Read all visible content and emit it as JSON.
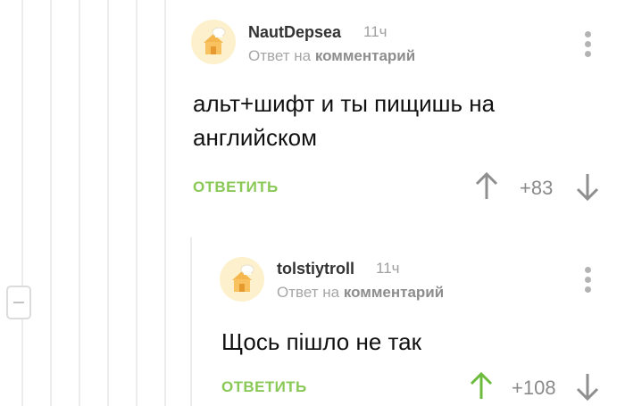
{
  "comments": [
    {
      "author": "NautDepsea",
      "time": "11ч",
      "reply_prefix": "Ответ на",
      "reply_target": "комментарий",
      "text": "альт+шифт и ты пищишь на английском",
      "reply_label": "ОТВЕТИТЬ",
      "score": "+83",
      "upvoted": false
    },
    {
      "author": "tolstiytroll",
      "time": "11ч",
      "reply_prefix": "Ответ на",
      "reply_target": "комментарий",
      "text": "Щось пішло не так",
      "reply_label": "ОТВЕТИТЬ",
      "score": "+108",
      "upvoted": true
    }
  ],
  "colors": {
    "accent_green": "#8ac858",
    "upvote_active": "#6cbb3c",
    "arrow_inactive": "#8f8f8f"
  },
  "icons": [
    "avatar-icon",
    "menu-dots-icon",
    "upvote-arrow-icon",
    "downvote-arrow-icon",
    "collapse-icon"
  ]
}
